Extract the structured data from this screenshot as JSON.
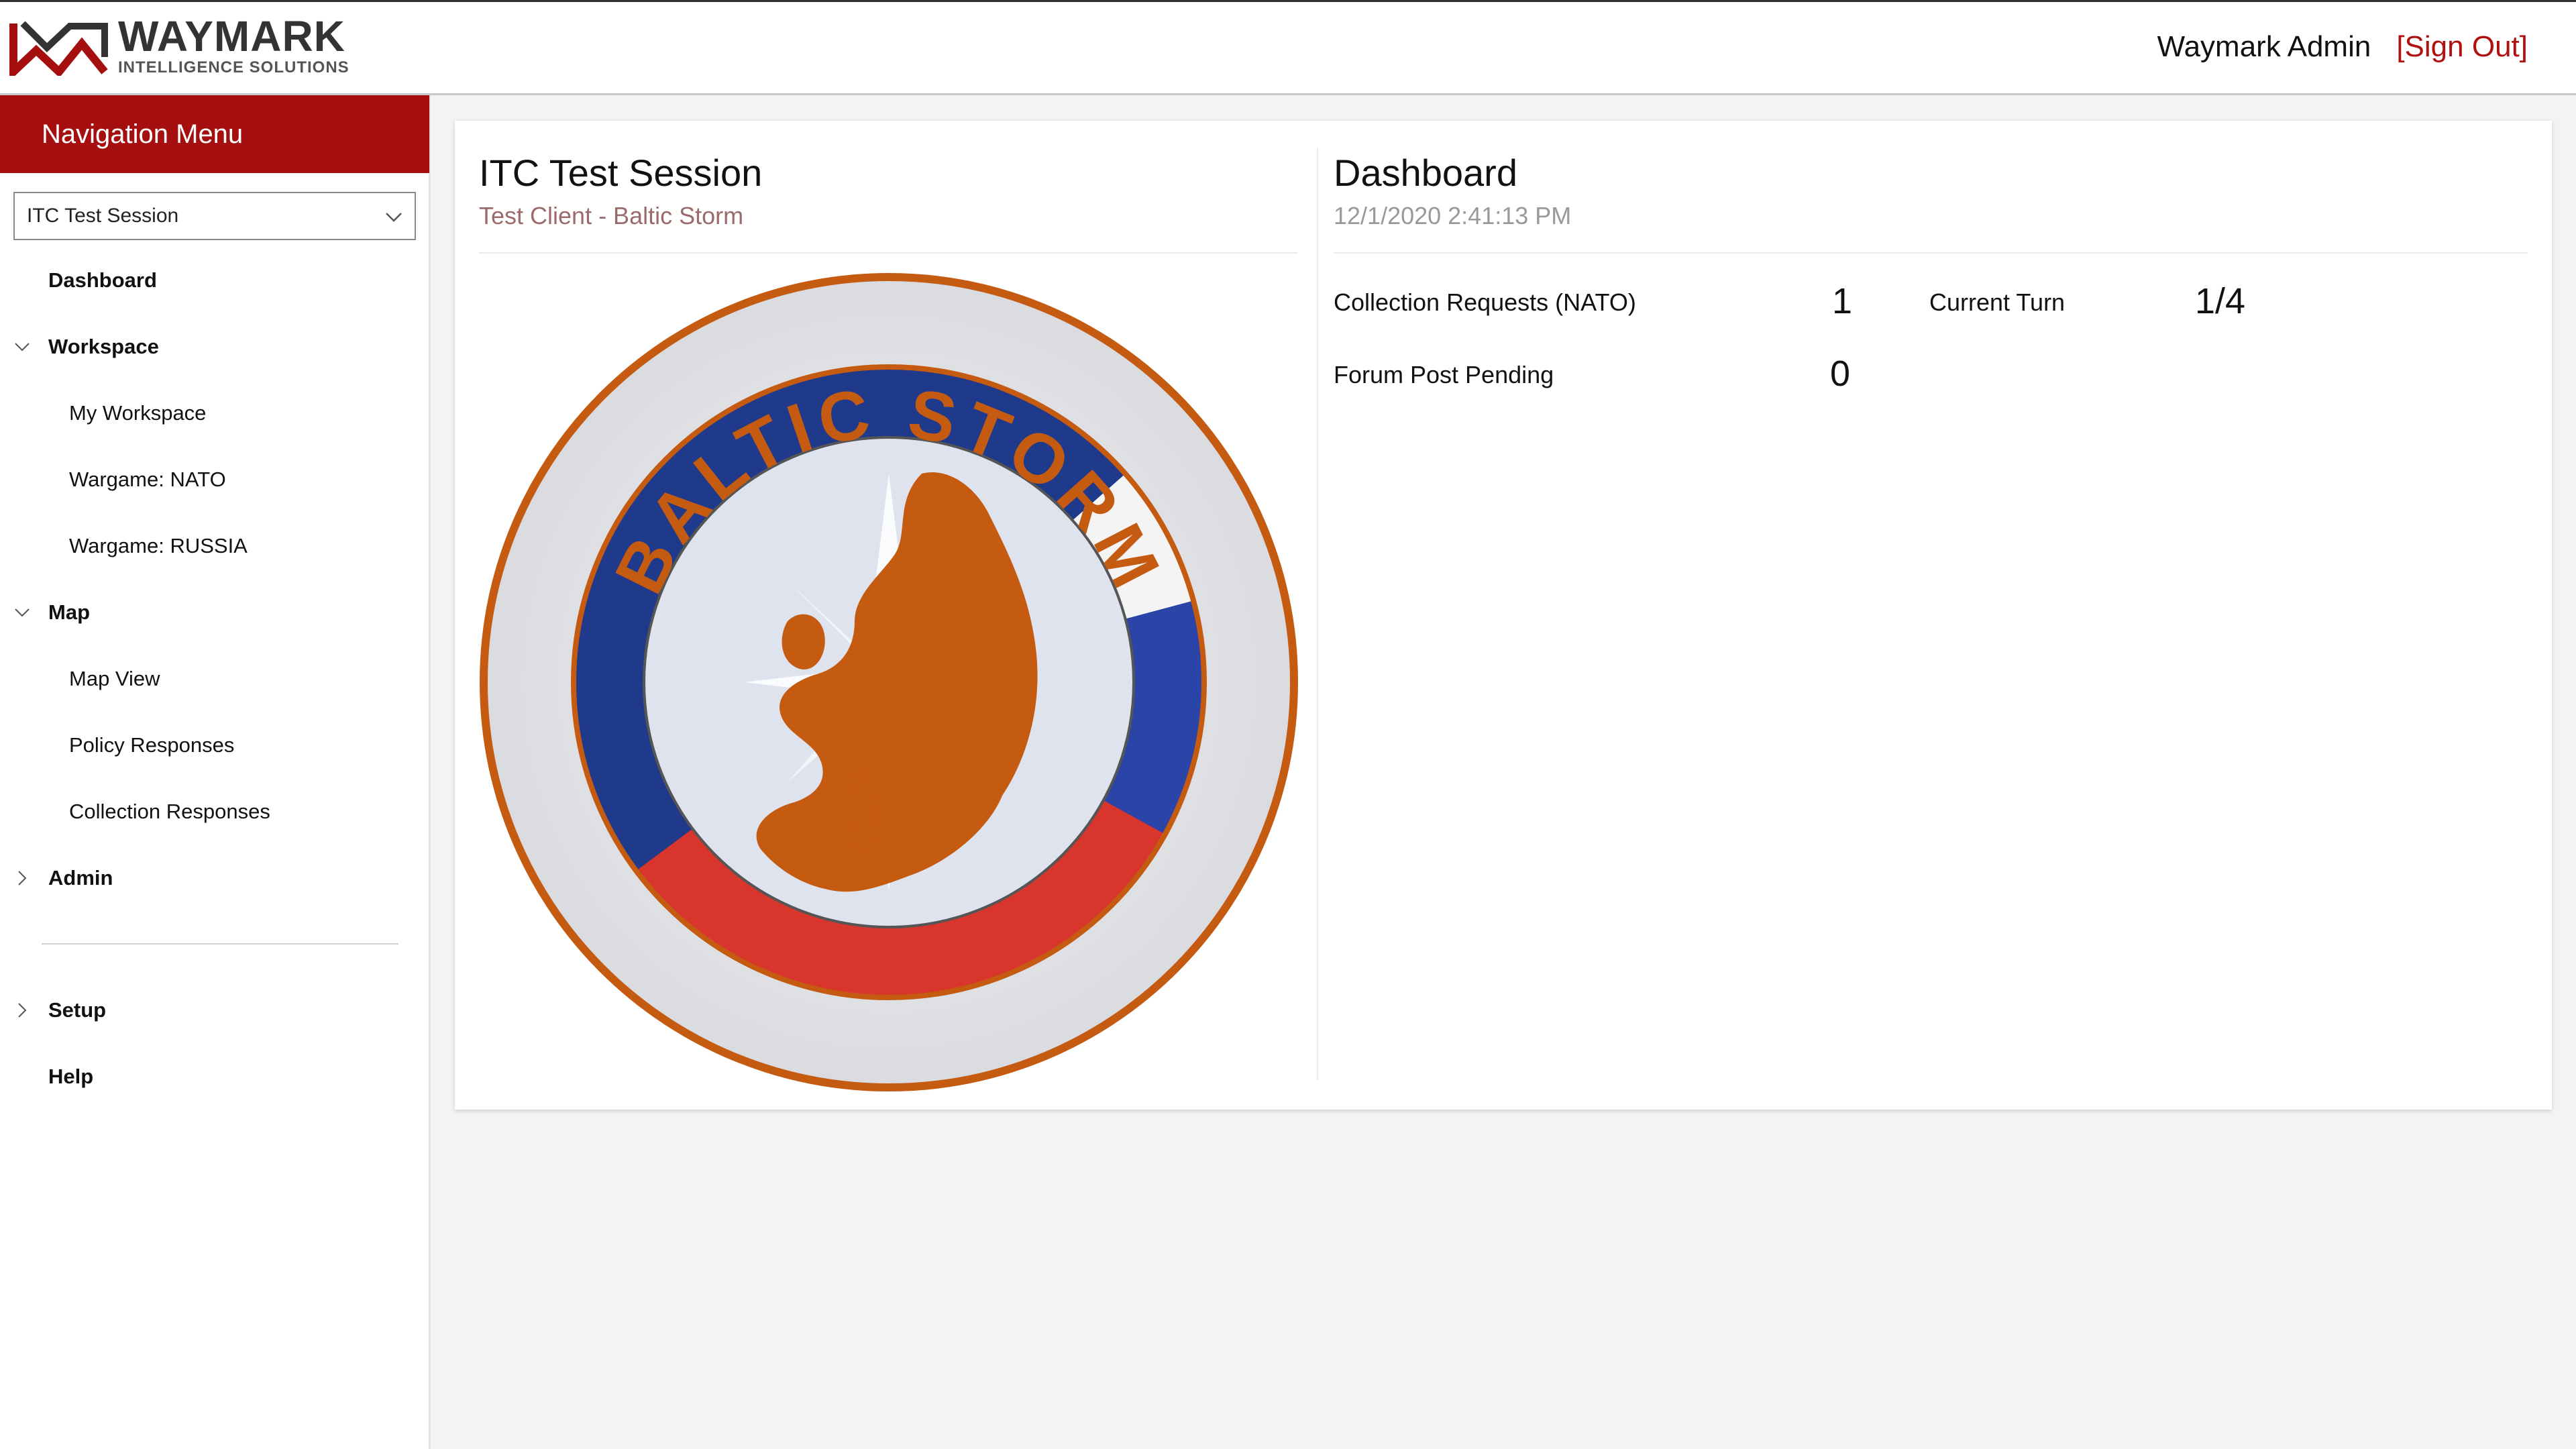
{
  "header": {
    "brand_name": "WAYMARK",
    "brand_sub": "INTELLIGENCE SOLUTIONS",
    "user_name": "Waymark Admin",
    "sign_out": "[Sign Out]"
  },
  "sidebar": {
    "title": "Navigation Menu",
    "session_select": "ITC Test Session",
    "items": [
      {
        "label": "Dashboard"
      },
      {
        "label": "Workspace",
        "expanded": true
      },
      {
        "label": "My Workspace"
      },
      {
        "label": "Wargame: NATO"
      },
      {
        "label": "Wargame: RUSSIA"
      },
      {
        "label": "Map",
        "expanded": true
      },
      {
        "label": "Map View"
      },
      {
        "label": "Policy Responses"
      },
      {
        "label": "Collection Responses"
      },
      {
        "label": "Admin",
        "expanded": false
      },
      {
        "label": "Setup",
        "expanded": false
      },
      {
        "label": "Help"
      }
    ]
  },
  "session": {
    "title": "ITC Test Session",
    "subtitle": "Test Client - Baltic Storm",
    "emblem_text": "BALTIC STORM"
  },
  "dashboard": {
    "title": "Dashboard",
    "timestamp": "12/1/2020 2:41:13 PM",
    "stats": [
      {
        "label": "Collection Requests (NATO)",
        "value": "1"
      },
      {
        "label": "Forum Post Pending",
        "value": "0"
      },
      {
        "label": "Current Turn",
        "value": "1/4"
      }
    ]
  },
  "colors": {
    "brand_red": "#a50f0f",
    "sign_out": "#b01010",
    "emblem_orange": "#c55a11",
    "nato_blue": "#1f3a8a",
    "russia_red": "#d8362c"
  }
}
